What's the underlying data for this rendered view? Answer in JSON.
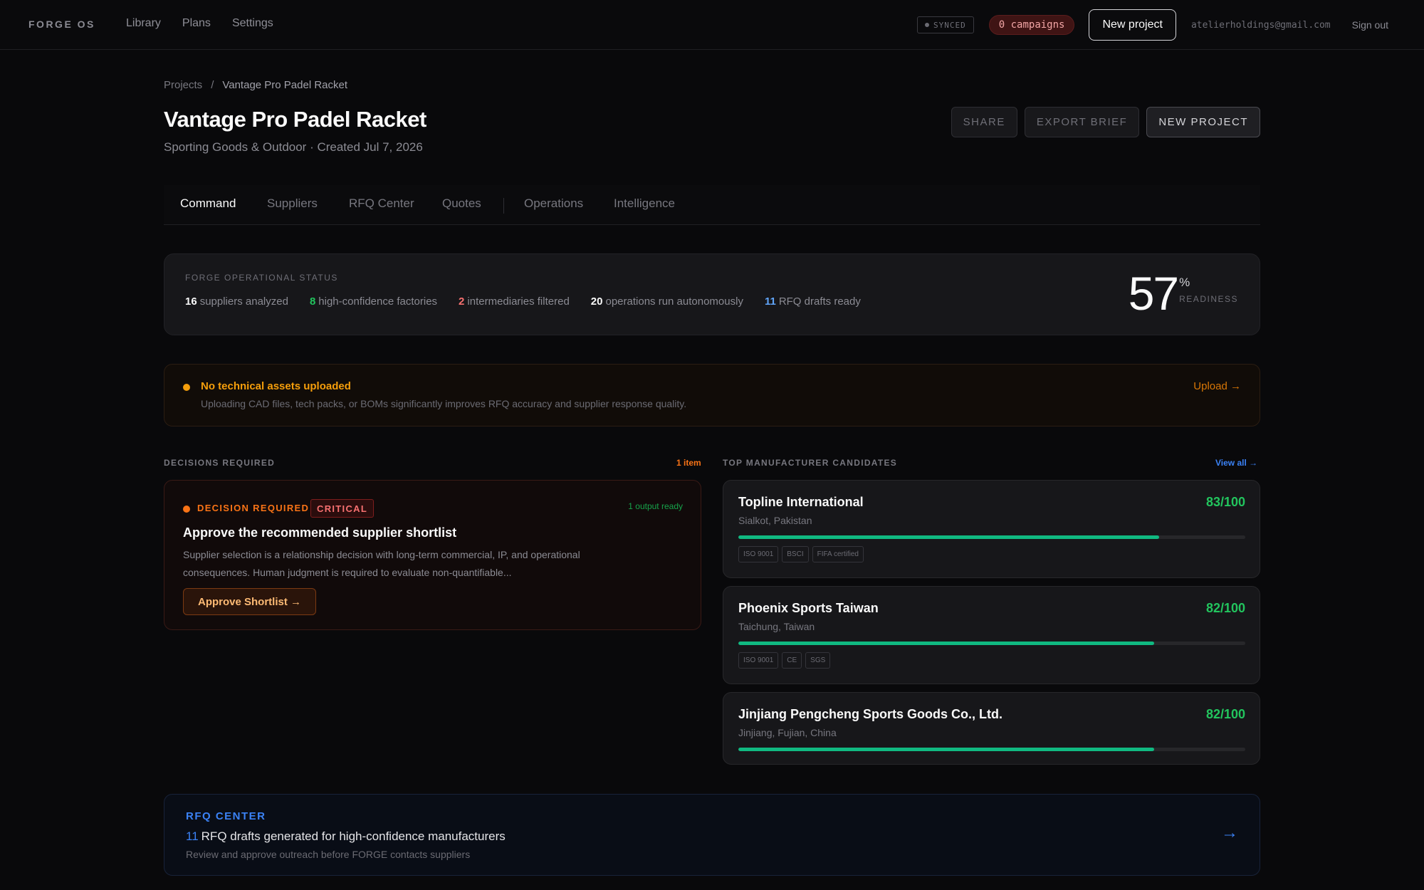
{
  "nav": {
    "brand": "FORGE OS",
    "links": [
      "Library",
      "Plans",
      "Settings"
    ],
    "synced": "SYNCED",
    "campaigns": "0 campaigns",
    "new_project": "New project",
    "email": "atelierholdings@gmail.com",
    "sign_out": "Sign out"
  },
  "breadcrumb": {
    "root": "Projects",
    "sep": "/",
    "current": "Vantage Pro Padel Racket"
  },
  "project": {
    "title": "Vantage Pro Padel Racket",
    "subtitle": "Sporting Goods & Outdoor · Created Jul 7, 2026"
  },
  "actions": {
    "share": "SHARE",
    "export": "EXPORT BRIEF",
    "new_project": "NEW PROJECT"
  },
  "tabs": [
    "Command",
    "Suppliers",
    "RFQ Center",
    "Quotes",
    "Operations",
    "Intelligence"
  ],
  "status": {
    "label": "FORGE OPERATIONAL STATUS",
    "stats": [
      {
        "value": "16",
        "text": "suppliers analyzed"
      },
      {
        "value": "8",
        "text": "high-confidence factories"
      },
      {
        "value": "2",
        "text": "intermediaries filtered"
      },
      {
        "value": "20",
        "text": "operations run autonomously"
      },
      {
        "value": "11",
        "text": "RFQ drafts ready"
      }
    ],
    "readiness_value": "57",
    "readiness_unit": "%",
    "readiness_label": "READINESS"
  },
  "alert": {
    "title": "No technical assets uploaded",
    "text": "Uploading CAD files, tech packs, or BOMs significantly improves RFQ accuracy and supplier response quality.",
    "link": "Upload →"
  },
  "decisions": {
    "label": "DECISIONS REQUIRED",
    "count": "1 item",
    "card": {
      "tag": "DECISION REQUIRED",
      "severity": "CRITICAL",
      "output": "1 output ready",
      "title": "Approve the recommended supplier shortlist",
      "body": "Supplier selection is a relationship decision with long-term commercial, IP, and operational consequences. Human judgment is required to evaluate non-quantifiable...",
      "button": "Approve Shortlist →"
    }
  },
  "manufacturers": {
    "label": "TOP MANUFACTURER CANDIDATES",
    "view_all": "View all →",
    "items": [
      {
        "name": "Topline International",
        "location": "Sialkot, Pakistan",
        "score": "83/100",
        "score_value": 83,
        "certs": [
          "ISO 9001",
          "BSCI",
          "FIFA certified"
        ]
      },
      {
        "name": "Phoenix Sports Taiwan",
        "location": "Taichung, Taiwan",
        "score": "82/100",
        "score_value": 82,
        "certs": [
          "ISO 9001",
          "CE",
          "SGS"
        ]
      },
      {
        "name": "Jinjiang Pengcheng Sports Goods Co., Ltd.",
        "location": "Jinjiang, Fujian, China",
        "score": "82/100",
        "score_value": 82,
        "certs": []
      }
    ]
  },
  "rfq": {
    "label": "RFQ CENTER",
    "count": "11",
    "title": "RFQ drafts generated for high-confidence manufacturers",
    "subtitle": "Review and approve outreach before FORGE contacts suppliers",
    "arrow": "→"
  },
  "colors": {
    "accent_green": "#22c55e",
    "accent_blue": "#3b82f6",
    "accent_orange": "#f97316",
    "warning": "#f59e0b",
    "critical": "#f87171"
  }
}
